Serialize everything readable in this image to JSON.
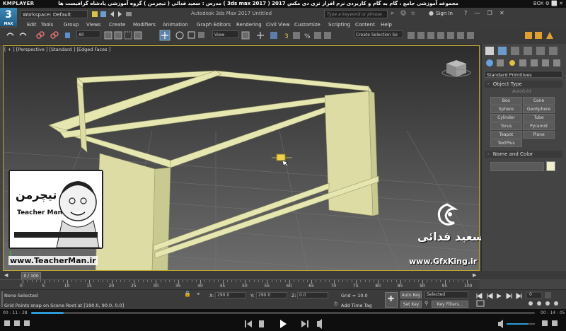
{
  "player": {
    "name": "KMPLAYER",
    "video_title": "مجموعه آموزشی جامع ، گام به گام و کاربردی نرم افزار تری دی مکس 2017  ( 3ds max 2017 )  مدرس : سعید فدائی ( تیچرمن ) گروه آموزشی پادشاه گرافیست ها",
    "top_right": "BOX ⚙ ⬜ ✕",
    "time_current": "00 : 11 : 28",
    "time_total": "00 : 14 : 05",
    "seek_fraction": 0.065
  },
  "app": {
    "logo_text": "3",
    "logo_sub": "MAX",
    "workspace_label": "Workspace: Default",
    "title": "Autodesk 3ds Max 2017      Untitled",
    "search_placeholder": "Type a keyword or phrase",
    "signin_label": "Sign In"
  },
  "menu": [
    "Edit",
    "Tools",
    "Group",
    "Views",
    "Create",
    "Modifiers",
    "Animation",
    "Graph Editors",
    "Rendering",
    "Civil View",
    "Customize",
    "Scripting",
    "Content",
    "Help"
  ],
  "toolbar": {
    "filter_dropdown": "All",
    "view_dropdown": "View",
    "selection_set": "Create Selection Se"
  },
  "viewport": {
    "label": "[ + ] [Perspective ] [Standard ] [Edged Faces ]",
    "object_color": "#e6e6b0",
    "border_color": "#bfa82e"
  },
  "command_panel": {
    "dropdown": "Standard Primitives",
    "object_type_title": "Object Type",
    "autogrid": "AutoGrid",
    "buttons": [
      "Box",
      "Cone",
      "Sphere",
      "GeoSphere",
      "Cylinder",
      "Tube",
      "Torus",
      "Pyramid",
      "Teapot",
      "Plane",
      "TextPlus"
    ],
    "name_color_title": "Name and Color"
  },
  "timeline": {
    "slider_label": "0 / 100",
    "ticks": [
      "0",
      "5",
      "10",
      "15",
      "20",
      "25",
      "30",
      "35",
      "40",
      "45",
      "50",
      "55",
      "60",
      "65",
      "70",
      "75",
      "80",
      "85",
      "90",
      "95",
      "100"
    ]
  },
  "status": {
    "selection": "None Selected",
    "prompt": "Grid Points snap on Scene Root at [190.0, 90.0, 0.0]",
    "x_label": "X:",
    "x_value": "290.0",
    "y_label": "Y:",
    "y_value": "290.0",
    "z_label": "Z:",
    "z_value": "0.0",
    "grid": "Grid = 10.0",
    "add_time_tag": "Add Time Tag",
    "auto_key": "Auto Key",
    "selected_dropdown": "Selected",
    "set_key": "Set Key",
    "key_filters": "Key Filters...",
    "frame": "0"
  },
  "watermark": {
    "teacherman_url": "www.TeacherMan.ir",
    "teacherman_name": "Teacher Man",
    "teacherman_fa": "تیچرمن",
    "gfx_url": "www.GfxKing.ir",
    "gfx_name": "سعید فدائی"
  }
}
